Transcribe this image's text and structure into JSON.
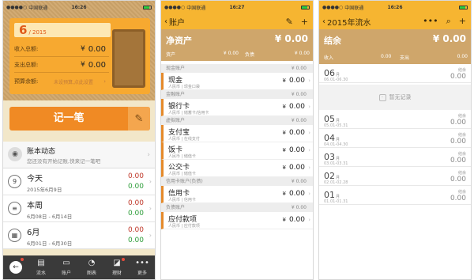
{
  "status": {
    "carrier": "中国联通",
    "times": [
      "16:26",
      "16:27",
      "16:26"
    ]
  },
  "p1": {
    "date_month": "6",
    "date_year": "/ 2015",
    "income_label": "收入总额:",
    "income_cur": "¥",
    "income_value": "0.00",
    "expense_label": "支出总额:",
    "expense_cur": "¥",
    "expense_value": "0.00",
    "budget_label": "预算余额:",
    "budget_note": "未设预算,点此设置",
    "record_label": "记一笔",
    "dynamic_title": "账本动态",
    "dynamic_sub": "您还没有开始记账,快来记一笔吧",
    "periods": [
      {
        "icon": "9",
        "title": "今天",
        "sub": "2015年6月9日",
        "income": "0.00",
        "expense": "0.00"
      },
      {
        "icon": "≡",
        "title": "本周",
        "sub": "6月08日 - 6月14日",
        "income": "0.00",
        "expense": "0.00"
      },
      {
        "icon": "▦",
        "title": "6月",
        "sub": "6月01日 - 6月30日",
        "income": "0.00",
        "expense": "0.00"
      }
    ],
    "tabs": [
      "",
      "流水",
      "账户",
      "图表",
      "理财",
      "更多"
    ]
  },
  "p2": {
    "back": "账户",
    "title": "净资产",
    "value": "¥ 0.00",
    "assets_label": "资产",
    "assets_value": "¥ 0.00",
    "liab_label": "负债",
    "liab_value": "¥ 0.00",
    "groups": [
      {
        "name": "现金账户",
        "total": "¥ 0.00",
        "accounts": [
          {
            "name": "现金",
            "sub": "人民币 | 现金口袋",
            "value": "0.00"
          }
        ]
      },
      {
        "name": "金融账户",
        "total": "¥ 0.00",
        "accounts": [
          {
            "name": "银行卡",
            "sub": "人民币 | 储蓄卡/信用卡",
            "value": "0.00"
          }
        ]
      },
      {
        "name": "虚拟账户",
        "total": "¥ 0.00",
        "accounts": [
          {
            "name": "支付宝",
            "sub": "人民币 | 在线支付",
            "value": "0.00"
          },
          {
            "name": "饭卡",
            "sub": "人民币 | 储值卡",
            "value": "0.00"
          },
          {
            "name": "公交卡",
            "sub": "人民币 | 储值卡",
            "value": "0.00"
          }
        ]
      },
      {
        "name": "信用卡账户(负债)",
        "total": "¥ 0.00",
        "accounts": [
          {
            "name": "信用卡",
            "sub": "人民币 | 信用卡",
            "value": "0.00"
          }
        ]
      },
      {
        "name": "负债账户",
        "total": "¥ 0.00",
        "accounts": [
          {
            "name": "应付款项",
            "sub": "人民币 | 应付款项",
            "value": "0.00"
          }
        ]
      }
    ]
  },
  "p3": {
    "back": "2015年流水",
    "title": "结余",
    "value": "¥ 0.00",
    "income_label": "收入",
    "income_value": "0.00",
    "expense_label": "支出",
    "expense_value": "0.00",
    "empty_text": "暂无记录",
    "months": [
      {
        "m": "06",
        "unit": "月",
        "range": "06.01-06.30",
        "jy": "结余",
        "v": "0.00"
      },
      {
        "m": "05",
        "unit": "月",
        "range": "05.01-05.31",
        "jy": "结余",
        "v": "0.00"
      },
      {
        "m": "04",
        "unit": "月",
        "range": "04.01-04.30",
        "jy": "结余",
        "v": "0.00"
      },
      {
        "m": "03",
        "unit": "月",
        "range": "03.01-03.31",
        "jy": "结余",
        "v": "0.00"
      },
      {
        "m": "02",
        "unit": "月",
        "range": "02.01-02.28",
        "jy": "结余",
        "v": "0.00"
      },
      {
        "m": "01",
        "unit": "月",
        "range": "01.01-01.31",
        "jy": "结余",
        "v": "0.00"
      }
    ]
  }
}
